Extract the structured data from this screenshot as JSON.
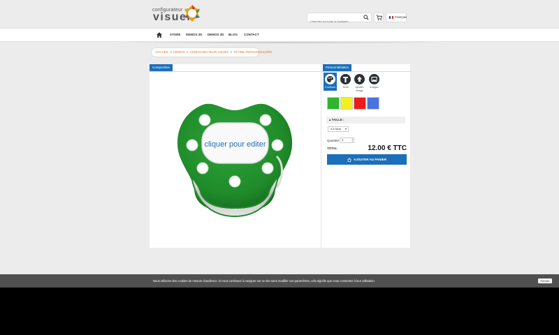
{
  "header": {
    "logo_top": "configurateur",
    "logo_main": "visuel",
    "search_placeholder": "Chercher sur toute la boutique...",
    "language": "Français",
    "icons": [
      "search-icon",
      "cart-icon",
      "flag-icon"
    ]
  },
  "nav": {
    "items": [
      "STORE",
      "DEMOS 2D",
      "DEMOS 3D",
      "BLOG",
      "CONTACT"
    ]
  },
  "breadcrumb": {
    "items": [
      "ACCUEIL",
      "DÉMOS",
      "CONFIGURATEUR VISUEL",
      "TÉTINE PERSONNALISÉE"
    ]
  },
  "composition": {
    "tab": "Composition",
    "edit_prompt": "cliquer pour editer"
  },
  "personnalisation": {
    "tab": "Personnalisation",
    "tools": [
      {
        "label": "Couleurs",
        "icon": "palette-icon"
      },
      {
        "label": "Texte",
        "icon": "text-icon"
      },
      {
        "label": "ajouter image",
        "icon": "upload-icon"
      },
      {
        "label": "Images",
        "icon": "image-icon"
      }
    ],
    "colors": [
      "#2fb52f",
      "#f3f01f",
      "#ef1b1b",
      "#4a73e0"
    ],
    "size_title": "TAILLE :",
    "size_value": "0-6 Mois",
    "qty_label": "Quantité",
    "qty_value": "1",
    "total_label": "TOTAL",
    "price": "12.00 € TTC",
    "add_to_cart": "AJOUTER AU PANIER"
  },
  "cookie": {
    "text": "Nous utilisons des cookies de mesure d'audience. Si vous continuez à naviguer sur ce site sans modifier vos paramètres, cela signifie que vous consentez à leur utilisation.",
    "close": "Fermer"
  },
  "theme": {
    "accent": "#1c6fb9",
    "breadcrumb_color": "#e4791c",
    "pacifier_green": "#1f8a2a"
  }
}
